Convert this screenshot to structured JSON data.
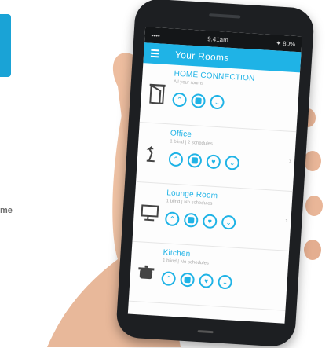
{
  "left_text": "me",
  "colors": {
    "accent": "#1fb3e6",
    "left_block": "#1aa3d6"
  },
  "phone": {
    "status_bar": {
      "left": "••••",
      "center": "9:41am",
      "right": "✦ 80%"
    },
    "app_bar": {
      "title": "Your Rooms",
      "menu_icon": "hamburger-icon"
    },
    "rooms": [
      {
        "name": "HOME CONNECTION",
        "subtitle": "All your rooms",
        "icon": "door-icon",
        "controls": [
          "up",
          "stop",
          "down"
        ]
      },
      {
        "name": "Office",
        "subtitle": "1 blind | 2 schedules",
        "icon": "desk-lamp-icon",
        "controls": [
          "up",
          "stop",
          "heart",
          "down"
        ]
      },
      {
        "name": "Lounge Room",
        "subtitle": "1 blind | No schedules",
        "icon": "monitor-icon",
        "controls": [
          "up",
          "stop",
          "heart",
          "down"
        ]
      },
      {
        "name": "Kitchen",
        "subtitle": "1 blind | No schedules",
        "icon": "pot-icon",
        "controls": [
          "up",
          "stop",
          "heart",
          "down"
        ]
      }
    ]
  }
}
